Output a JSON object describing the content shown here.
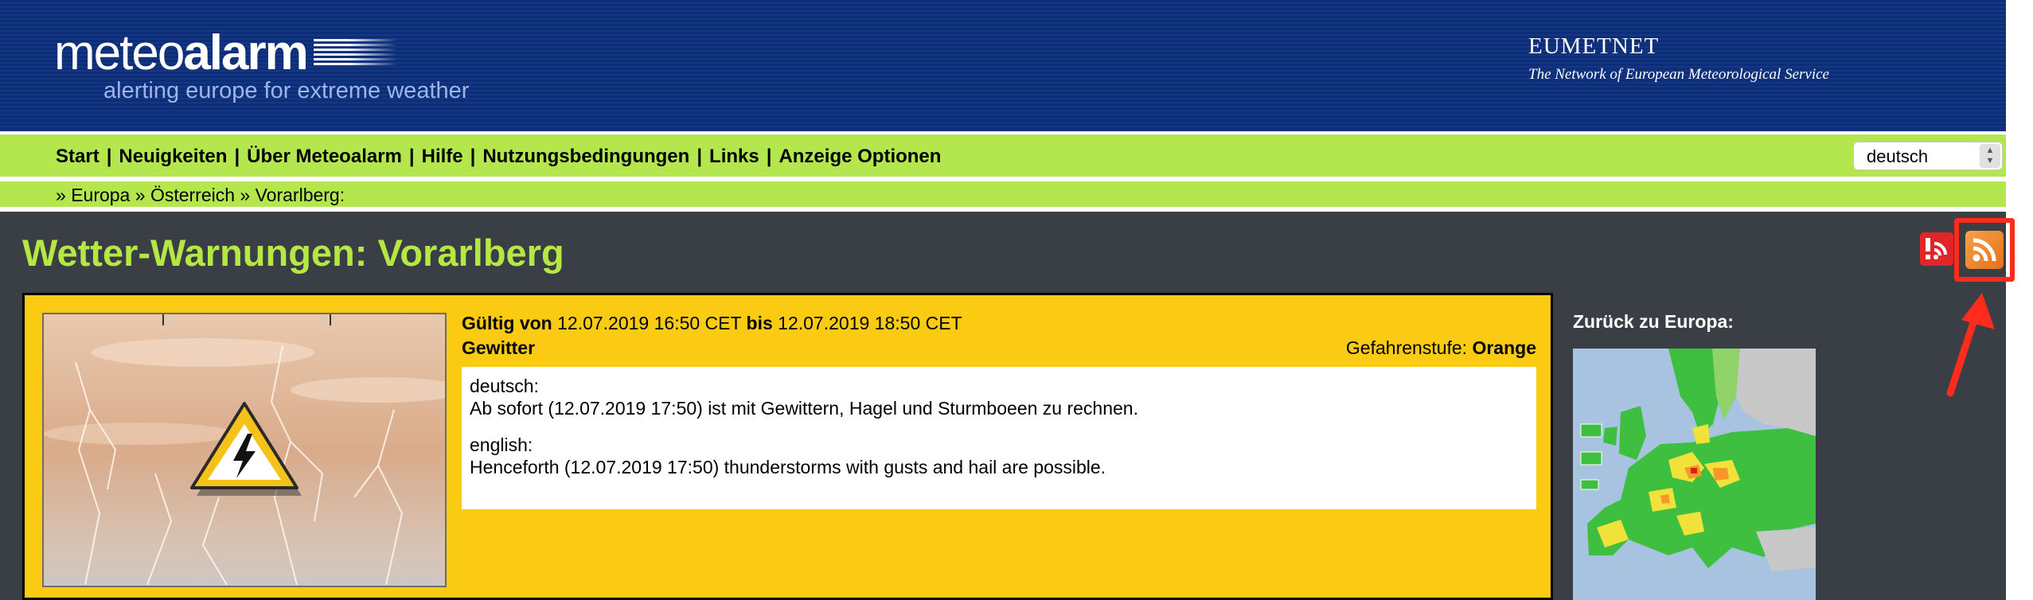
{
  "header": {
    "logo": {
      "part1": "meteo",
      "part2": "alarm",
      "tagline": "alerting europe for extreme weather"
    },
    "partner": {
      "name": "EUMETNET",
      "tagline": "The Network of European Meteorological Service"
    }
  },
  "nav": {
    "items": [
      "Start",
      "Neuigkeiten",
      "Über Meteoalarm",
      "Hilfe",
      "Nutzungsbedingungen",
      "Links",
      "Anzeige Optionen"
    ],
    "language": {
      "selected": "deutsch"
    }
  },
  "breadcrumb": {
    "items": [
      "Europa",
      "Österreich",
      "Vorarlberg:"
    ]
  },
  "page": {
    "title": "Wetter-Warnungen: Vorarlberg"
  },
  "warning": {
    "valid_from_label": "Gültig von",
    "valid_from": "12.07.2019 16:50 CET",
    "valid_to_label": "bis",
    "valid_to": "12.07.2019 18:50 CET",
    "type": "Gewitter",
    "level_label": "Gefahrenstufe:",
    "level": "Orange",
    "texts": [
      {
        "lang": "deutsch:",
        "text": "Ab sofort (12.07.2019 17:50) ist mit Gewittern, Hagel und Sturmboeen zu rechnen."
      },
      {
        "lang": "english:",
        "text": "Henceforth (12.07.2019 17:50) thunderstorms with gusts and hail are possible."
      }
    ]
  },
  "sidebar": {
    "back_label": "Zurück zu Europa:"
  },
  "icons": {
    "warning": "thunderstorm-warning-icon",
    "alert_feed": "alert-feed-icon",
    "rss": "rss-feed-icon"
  },
  "colors": {
    "header_bg": "#0b2d7a",
    "nav_bg": "#b3e74d",
    "content_bg": "#3a3f45",
    "title": "#b6e844",
    "warning_orange_box": "#fbcb13",
    "highlight": "#ff2b1c"
  }
}
